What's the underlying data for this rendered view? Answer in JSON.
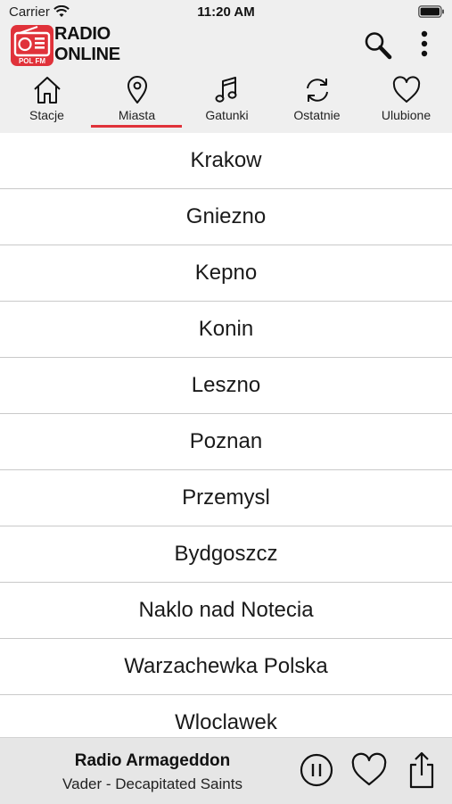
{
  "status_bar": {
    "carrier": "Carrier",
    "time": "11:20 AM"
  },
  "header": {
    "brand_line1": "RADIO",
    "brand_line2": "ONLINE",
    "logo_text": "POL FM"
  },
  "tabs": [
    {
      "label": "Stacje",
      "icon": "home-icon"
    },
    {
      "label": "Miasta",
      "icon": "location-pin-icon",
      "active": true
    },
    {
      "label": "Gatunki",
      "icon": "music-note-icon"
    },
    {
      "label": "Ostatnie",
      "icon": "refresh-icon"
    },
    {
      "label": "Ulubione",
      "icon": "heart-icon"
    }
  ],
  "cities": [
    "Krakow",
    "Gniezno",
    "Kepno",
    "Konin",
    "Leszno",
    "Poznan",
    "Przemysl",
    "Bydgoszcz",
    "Naklo nad Notecia",
    "Warzachewka Polska",
    "Wloclawek"
  ],
  "player": {
    "station": "Radio Armageddon",
    "track": "Vader - Decapitated Saints"
  },
  "colors": {
    "accent": "#e0323a",
    "header_bg": "#efefef",
    "player_bg": "#e6e6e6"
  }
}
